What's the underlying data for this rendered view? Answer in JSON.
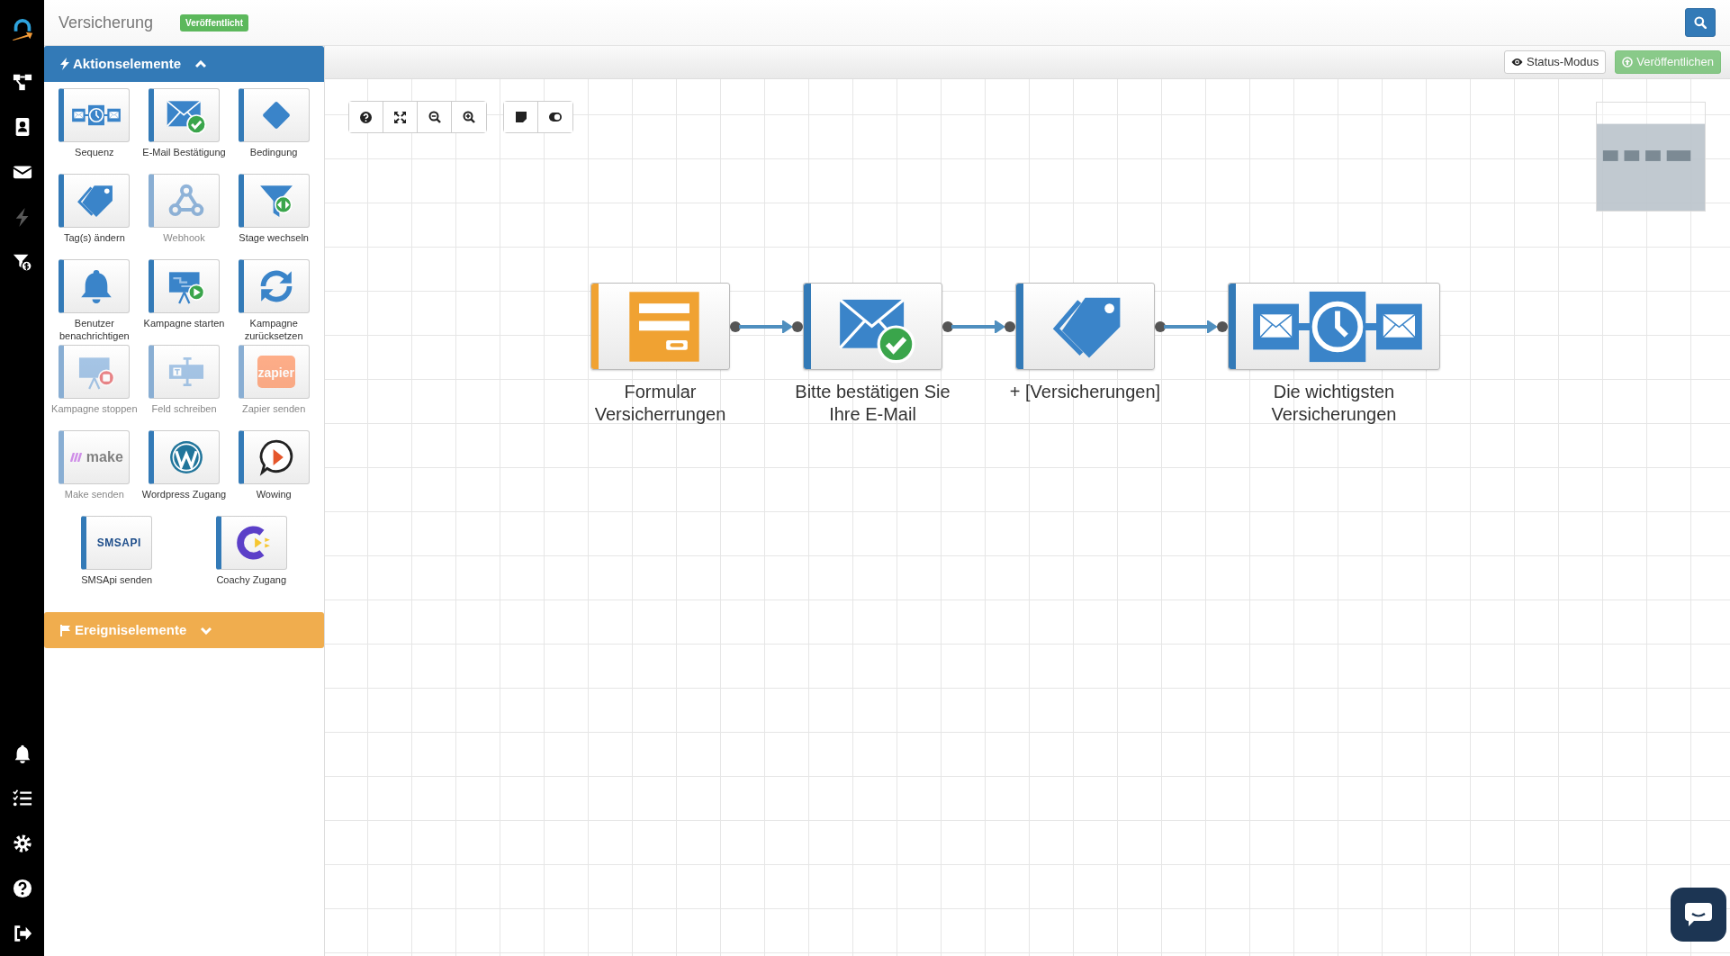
{
  "app": {
    "title": "Versicherung",
    "status_badge": "Veröffentlicht"
  },
  "nav_top": [
    {
      "kind": "logo",
      "disabled": false
    },
    {
      "kind": "flow",
      "disabled": false
    },
    {
      "kind": "contacts",
      "disabled": false
    },
    {
      "kind": "mail",
      "disabled": false
    },
    {
      "kind": "bolt",
      "disabled": true
    },
    {
      "kind": "funnel",
      "disabled": false
    }
  ],
  "nav_bottom": [
    {
      "kind": "bell"
    },
    {
      "kind": "checklist"
    },
    {
      "kind": "gear"
    },
    {
      "kind": "help"
    },
    {
      "kind": "logout"
    }
  ],
  "palette": {
    "sections": [
      {
        "title": "Aktionselemente",
        "kind": "action",
        "expanded": true,
        "tiles": [
          {
            "kind": "sequence",
            "label": "Sequenz",
            "disabled": false
          },
          {
            "kind": "email-confirm",
            "label": "E-Mail Bestätigung",
            "disabled": false
          },
          {
            "kind": "condition",
            "label": "Bedingung",
            "disabled": false
          },
          {
            "kind": "tag",
            "label": "Tag(s) ändern",
            "disabled": false
          },
          {
            "kind": "webhook",
            "label": "Webhook",
            "disabled": true
          },
          {
            "kind": "stage",
            "label": "Stage wechseln",
            "disabled": false
          },
          {
            "kind": "bell",
            "label": "Benutzer benachrichtigen",
            "disabled": false
          },
          {
            "kind": "campaign-start",
            "label": "Kampagne starten",
            "disabled": false
          },
          {
            "kind": "reset",
            "label": "Kampagne zurücksetzen",
            "disabled": false
          },
          {
            "kind": "campaign-stop",
            "label": "Kampagne stoppen",
            "disabled": true
          },
          {
            "kind": "field-write",
            "label": "Feld schreiben",
            "disabled": true
          },
          {
            "kind": "zapier",
            "label": "Zapier senden",
            "disabled": true,
            "logo_text": "zapier"
          },
          {
            "kind": "make",
            "label": "Make senden",
            "disabled": true,
            "logo_text": "make"
          },
          {
            "kind": "wordpress",
            "label": "Wordpress Zugang",
            "disabled": false
          },
          {
            "kind": "wowing",
            "label": "Wowing",
            "disabled": false
          },
          {
            "kind": "smsapi",
            "label": "SMSApi senden",
            "disabled": false,
            "logo_text": "SMSAPI"
          },
          {
            "kind": "coachy",
            "label": "Coachy Zugang",
            "disabled": false
          }
        ]
      },
      {
        "title": "Ereigniselemente",
        "kind": "event",
        "expanded": false
      }
    ]
  },
  "toolbar": {
    "buttons": [
      {
        "kind": "status",
        "label": "Status-Modus",
        "disabled": false
      },
      {
        "kind": "publish",
        "label": "Veröffentlichen",
        "disabled": true
      }
    ]
  },
  "canvas": {
    "nodes": [
      {
        "kind": "form",
        "color": "#f0a232",
        "label": "Formular Versicherrungen"
      },
      {
        "kind": "email-confirm",
        "color": "#337ab7",
        "label": "Bitte bestätigen Sie Ihre E-Mail"
      },
      {
        "kind": "tag",
        "color": "#337ab7",
        "label": "+ [Versicherungen]"
      },
      {
        "kind": "sequence",
        "color": "#337ab7",
        "label": "Die wichtigsten Versicherungen"
      }
    ]
  }
}
